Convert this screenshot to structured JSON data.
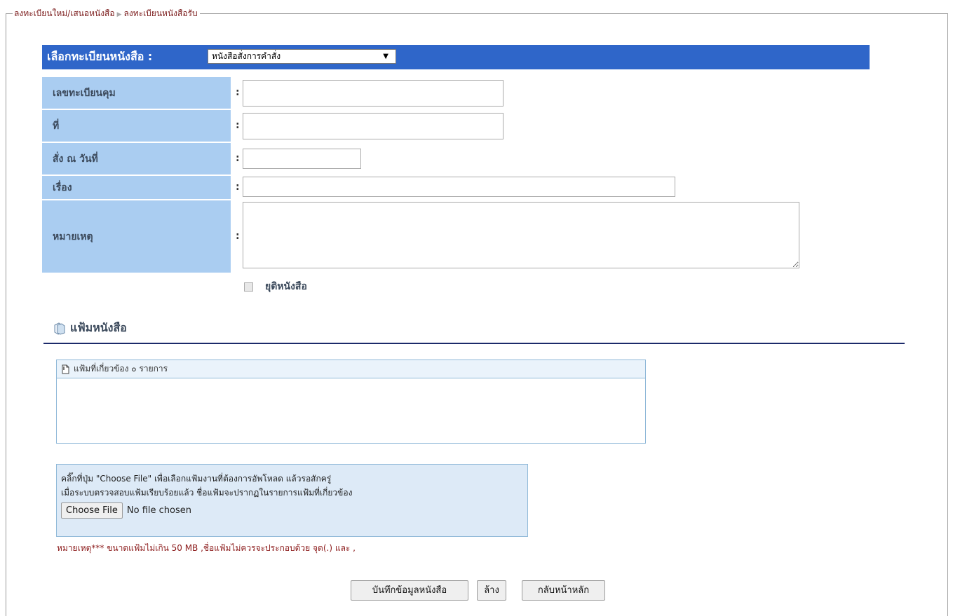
{
  "breadcrumb": {
    "part1": "ลงทะเบียนใหม่/เสนอหนังสือ",
    "part2": "ลงทะเบียนหนังสือรับ"
  },
  "header": {
    "title": "เลือกทะเบียนหนังสือ :",
    "select_value": "หนังสือสั่งการคำสั่ง"
  },
  "form": {
    "fields": [
      {
        "label": "เลขทะเบียนคุม",
        "value": ""
      },
      {
        "label": "ที่",
        "value": ""
      },
      {
        "label": "สั่ง ณ วันที่",
        "value": ""
      },
      {
        "label": "เรื่อง",
        "value": ""
      },
      {
        "label": "หมายเหตุ",
        "value": ""
      }
    ],
    "colon": ":",
    "checkbox_label": "ยุติหนังสือ",
    "checkbox_checked": false
  },
  "files": {
    "section_title": "แฟ้มหนังสือ",
    "related_header": "แฟ้มที่เกี่ยวข้อง ๐ รายการ",
    "upload_instruction_1": "คลิ๊กที่ปุ่ม \"Choose File\" เพื่อเลือกแฟ้มงานที่ต้องการอัพโหลด แล้วรอสักครู่",
    "upload_instruction_2": "เมื่อระบบตรวจสอบแฟ้มเรียบร้อยแล้ว ชื่อแฟ้มจะปรากฏในรายการแฟ้มที่เกี่ยวข้อง",
    "choose_button": "Choose File",
    "no_file": "No file chosen",
    "note": "หมายเหตุ*** ขนาดแฟ้มไม่เกิน 50 MB ,ชื่อแฟ้มไม่ควรจะประกอบด้วย จุด(.) และ ,"
  },
  "actions": {
    "save": "บันทึกข้อมูลหนังสือ",
    "clear": "ล้าง",
    "back": "กลับหน้าหลัก"
  },
  "colors": {
    "header_bar": "#2f66c9",
    "label_bg": "#aacdf1",
    "breadcrumb_text": "#7a1a1a",
    "note_text": "#8b1a1a"
  }
}
